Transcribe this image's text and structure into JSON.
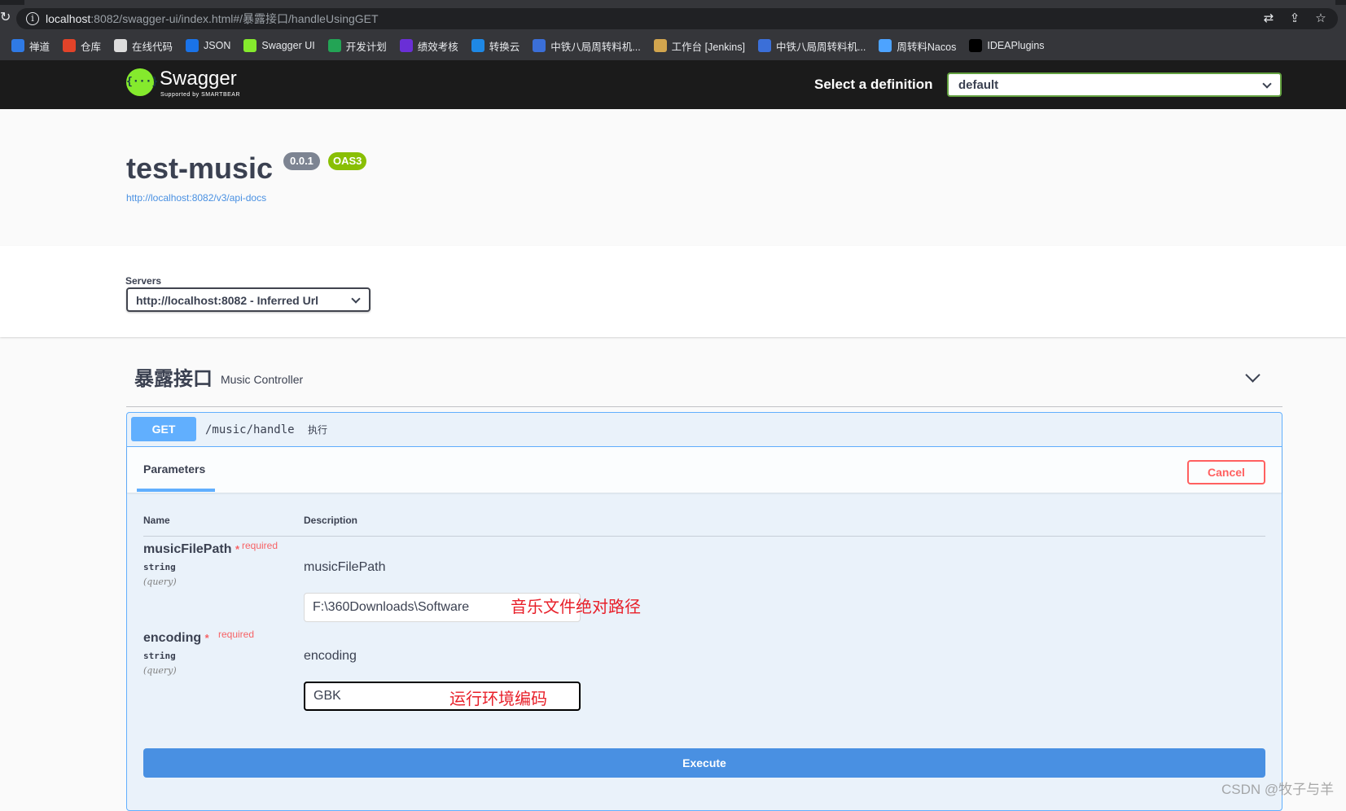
{
  "browser": {
    "url_host": "localhost",
    "url_rest": ":8082/swagger-ui/index.html#/暴露接口/handleUsingGET",
    "bookmarks": [
      {
        "label": "禅道",
        "color": "#2f7ae5",
        "icon": "chandao-icon"
      },
      {
        "label": "仓库",
        "color": "#e24329",
        "icon": "gitlab-icon"
      },
      {
        "label": "在线代码",
        "color": "#dcdcdc",
        "icon": "document-icon"
      },
      {
        "label": "JSON",
        "color": "#1a73e8",
        "icon": "json-icon"
      },
      {
        "label": "Swagger UI",
        "color": "#85ea2d",
        "icon": "swagger-icon"
      },
      {
        "label": "开发计划",
        "color": "#23a455",
        "icon": "sheet-icon"
      },
      {
        "label": "绩效考核",
        "color": "#6a2fd6",
        "icon": "performance-icon"
      },
      {
        "label": "转换云",
        "color": "#1e88e5",
        "icon": "cloud-icon"
      },
      {
        "label": "中铁八局周转料机...",
        "color": "#3b6fd8",
        "icon": "globe-icon"
      },
      {
        "label": "工作台 [Jenkins]",
        "color": "#d2a54e",
        "icon": "jenkins-icon"
      },
      {
        "label": "中铁八局周转料机...",
        "color": "#3b6fd8",
        "icon": "globe-icon"
      },
      {
        "label": "周转料Nacos",
        "color": "#4da3ff",
        "icon": "nacos-icon"
      },
      {
        "label": "IDEAPlugins",
        "color": "#000000",
        "icon": "idea-icon"
      }
    ]
  },
  "topbar": {
    "logo_text": "Swagger",
    "logo_sub": "Supported by SMARTBEAR",
    "select_label": "Select a definition",
    "definition": "default"
  },
  "info": {
    "title": "test-music",
    "version": "0.0.1",
    "oas": "OAS3",
    "spec_url": "http://localhost:8082/v3/api-docs"
  },
  "servers": {
    "label": "Servers",
    "selected": "http://localhost:8082 - Inferred Url"
  },
  "tag": {
    "name": "暴露接口",
    "description": "Music Controller"
  },
  "operation": {
    "method": "GET",
    "path": "/music/handle",
    "summary": "执行",
    "tab": "Parameters",
    "cancel": "Cancel",
    "col_name": "Name",
    "col_description": "Description",
    "params": [
      {
        "name": "musicFilePath",
        "star": "*",
        "required": "required",
        "type": "string",
        "in": "(query)",
        "description": "musicFilePath",
        "value": "F:\\360Downloads\\Software",
        "annotation": "音乐文件绝对路径"
      },
      {
        "name": "encoding",
        "star": "*",
        "required": "required",
        "type": "string",
        "in": "(query)",
        "description": "encoding",
        "value": "GBK",
        "annotation": "运行环境编码"
      }
    ],
    "execute": "Execute"
  },
  "watermark": "CSDN @牧子与羊",
  "colors": {
    "get": "#61affe",
    "execute": "#4990e2",
    "cancel": "#ff6060",
    "oas_badge": "#89bf04",
    "annotation": "#e8202a"
  }
}
